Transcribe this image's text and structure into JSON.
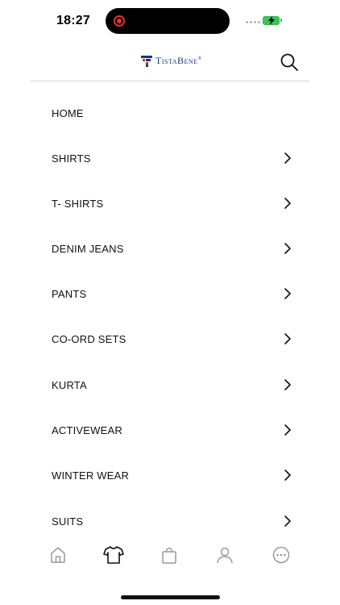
{
  "status_bar": {
    "time": "18:27"
  },
  "header": {
    "logo_text": "TistaBene",
    "logo_mark": "®",
    "search_icon": "search-icon"
  },
  "menu": {
    "items": [
      {
        "label": "HOME",
        "has_chevron": false
      },
      {
        "label": "SHIRTS",
        "has_chevron": true
      },
      {
        "label": "T- SHIRTS",
        "has_chevron": true
      },
      {
        "label": "DENIM JEANS",
        "has_chevron": true
      },
      {
        "label": "PANTS",
        "has_chevron": true
      },
      {
        "label": "CO-ORD SETS",
        "has_chevron": true
      },
      {
        "label": "KURTA",
        "has_chevron": true
      },
      {
        "label": "ACTIVEWEAR",
        "has_chevron": true
      },
      {
        "label": "WINTER WEAR",
        "has_chevron": true
      },
      {
        "label": "SUITS",
        "has_chevron": true
      }
    ]
  },
  "tab_bar": {
    "tabs": [
      {
        "icon": "home-icon",
        "active": false
      },
      {
        "icon": "tshirt-icon",
        "active": true
      },
      {
        "icon": "shopping-bag-icon",
        "active": false
      },
      {
        "icon": "profile-icon",
        "active": false
      },
      {
        "icon": "more-icon",
        "active": false
      }
    ]
  },
  "colors": {
    "brand": "#123a7a",
    "recording": "#e5322d",
    "battery": "#34c759",
    "tab_inactive": "#9a9a9a",
    "tab_active": "#111111"
  }
}
